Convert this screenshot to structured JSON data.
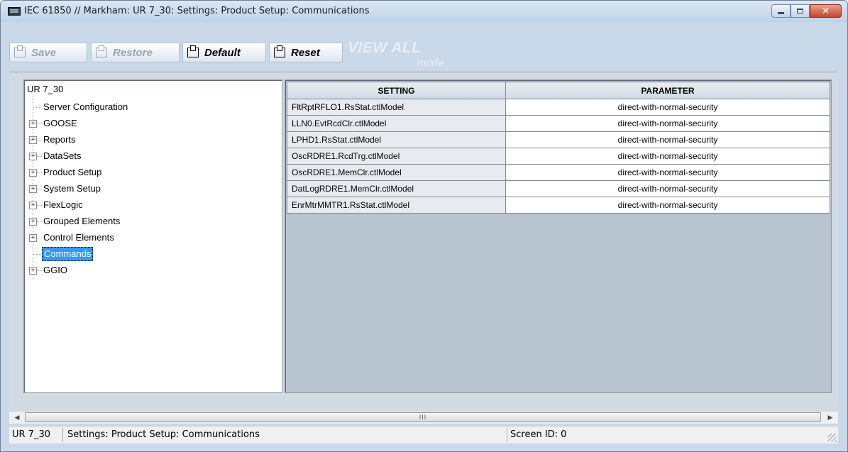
{
  "window": {
    "title": "IEC 61850 // Markham: UR 7_30: Settings: Product Setup: Communications",
    "controls": {
      "minimize": "minimize",
      "maximize": "maximize",
      "close": "✕"
    }
  },
  "toolbar": {
    "save_label": "Save",
    "restore_label": "Restore",
    "default_label": "Default",
    "reset_label": "Reset",
    "view_all_label": "VIEW ALL",
    "view_all_mode": "mode"
  },
  "tree": {
    "root": "UR 7_30",
    "items": [
      {
        "label": "Server Configuration",
        "expandable": false
      },
      {
        "label": "GOOSE",
        "expandable": true
      },
      {
        "label": "Reports",
        "expandable": true
      },
      {
        "label": "DataSets",
        "expandable": true
      },
      {
        "label": "Product Setup",
        "expandable": true
      },
      {
        "label": "System Setup",
        "expandable": true
      },
      {
        "label": "FlexLogic",
        "expandable": true
      },
      {
        "label": "Grouped Elements",
        "expandable": true
      },
      {
        "label": "Control Elements",
        "expandable": true
      },
      {
        "label": "Commands",
        "expandable": false,
        "selected": true
      },
      {
        "label": "GGIO",
        "expandable": true
      }
    ]
  },
  "grid": {
    "headers": {
      "setting": "SETTING",
      "parameter": "PARAMETER"
    },
    "rows": [
      {
        "setting": "FltRptRFLO1.RsStat.ctlModel",
        "parameter": "direct-with-normal-security"
      },
      {
        "setting": "LLN0.EvtRcdClr.ctlModel",
        "parameter": "direct-with-normal-security"
      },
      {
        "setting": "LPHD1.RsStat.ctlModel",
        "parameter": "direct-with-normal-security"
      },
      {
        "setting": "OscRDRE1.RcdTrg.ctlModel",
        "parameter": "direct-with-normal-security"
      },
      {
        "setting": "OscRDRE1.MemClr.ctlModel",
        "parameter": "direct-with-normal-security"
      },
      {
        "setting": "DatLogRDRE1.MemClr.ctlModel",
        "parameter": "direct-with-normal-security"
      },
      {
        "setting": "EnrMtrMMTR1.RsStat.ctlModel",
        "parameter": "direct-with-normal-security"
      }
    ]
  },
  "scrollbar": {
    "thumb_grip": "III",
    "left_arrow": "◀",
    "right_arrow": "▶"
  },
  "status": {
    "device": "UR 7_30",
    "path": "Settings: Product Setup: Communications",
    "screen_id": "Screen ID: 0"
  }
}
